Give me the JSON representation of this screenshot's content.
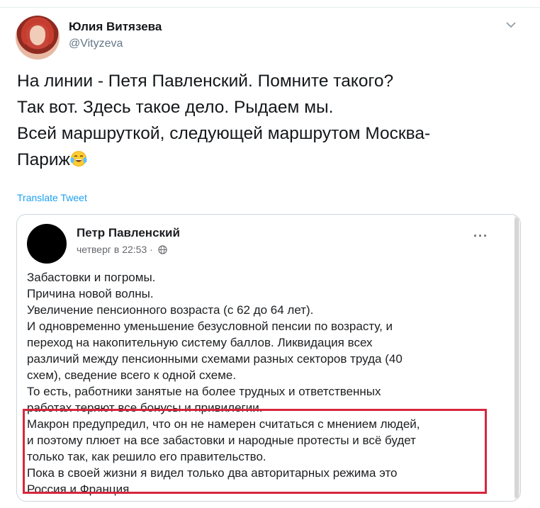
{
  "tweet": {
    "author_name": "Юлия Витязева",
    "author_handle": "@Vityzeva",
    "text_lines": [
      "На линии - Петя Павленский. Помните такого?",
      "Так вот. Здесь такое дело. Рыдаем мы.",
      "Всей маршруткой, следующей маршрутом Москва-",
      "Париж"
    ],
    "emoji_icon": "tears-of-joy-emoji",
    "translate_label": "Translate Tweet"
  },
  "embedded_post": {
    "author_name": "Петр Павленский",
    "timestamp": "четверг в 22:53 ·",
    "globe_icon": "globe-icon",
    "more_label": "···",
    "text_lines": [
      "Забастовки и погромы.",
      "Причина новой волны.",
      "Увеличение пенсионного возраста (с 62 до 64 лет).",
      "И одновременно уменьшение безусловной пенсии по возрасту, и",
      "переход на накопительную систему баллов. Ликвидация всех",
      "различий между пенсионными схемами разных секторов труда (40",
      "схем), сведение всего к одной схеме.",
      "То есть, работники занятые на более трудных и ответственных",
      "работах теряют все бонусы и привилегии.",
      "Макрон предупредил, что он не намерен считаться с мнением людей,",
      "и поэтому плюет на все забастовки и народные протесты и всё будет",
      "только так, как решило его правительство.",
      "Пока в своей жизни я видел только два авторитарных режима это",
      "Россия и Франция."
    ],
    "highlight_color": "#d7263d"
  },
  "colors": {
    "link": "#1da1f2",
    "secondary_text": "#657786",
    "border": "#ccd6dd"
  }
}
